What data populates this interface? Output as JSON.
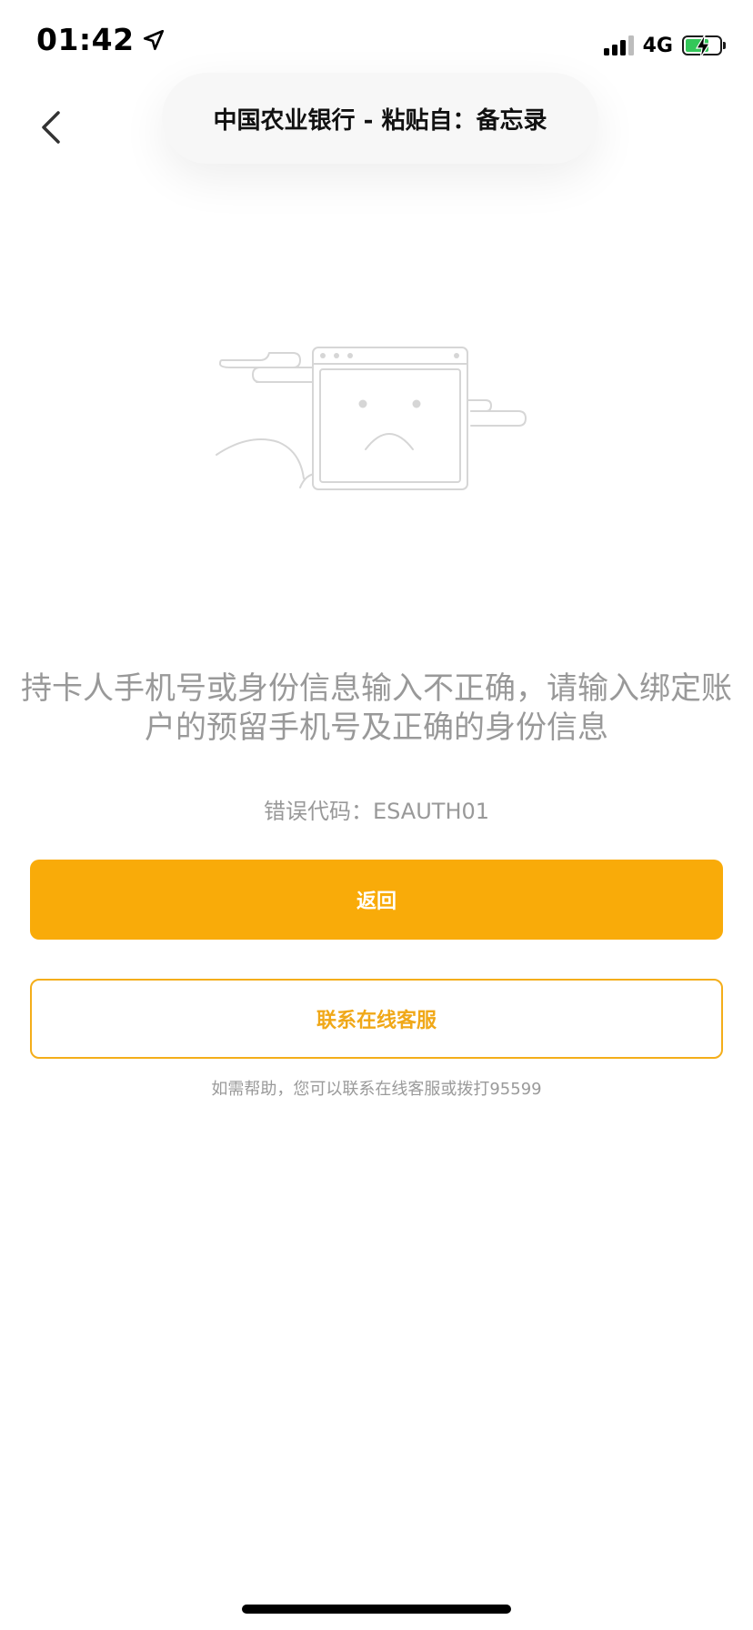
{
  "status_bar": {
    "time": "01:42",
    "network": "4G"
  },
  "header": {
    "title": "中国农业银行 - 粘贴自：备忘录"
  },
  "error": {
    "message": "持卡人手机号或身份信息输入不正确，请输入绑定账户的预留手机号及正确的身份信息",
    "code_label": "错误代码：",
    "code": "ESAUTH01"
  },
  "actions": {
    "back_label": "返回",
    "contact_label": "联系在线客服"
  },
  "help": {
    "text": "如需帮助，您可以联系在线客服或拨打95599"
  },
  "colors": {
    "accent": "#f9ab09",
    "text_muted": "#999999",
    "battery": "#33c759"
  }
}
